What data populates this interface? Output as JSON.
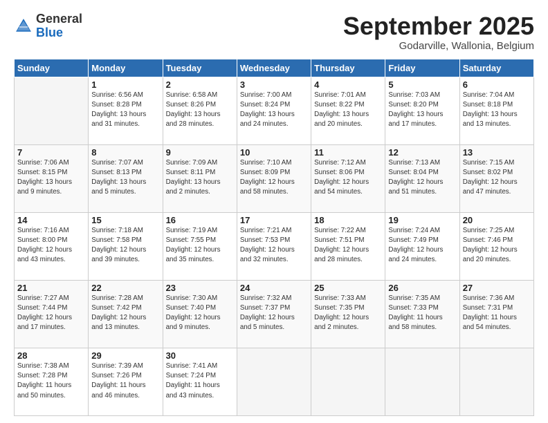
{
  "logo": {
    "general": "General",
    "blue": "Blue"
  },
  "title": {
    "month": "September 2025",
    "location": "Godarville, Wallonia, Belgium"
  },
  "weekdays": [
    "Sunday",
    "Monday",
    "Tuesday",
    "Wednesday",
    "Thursday",
    "Friday",
    "Saturday"
  ],
  "weeks": [
    [
      {
        "day": "",
        "info": ""
      },
      {
        "day": "1",
        "info": "Sunrise: 6:56 AM\nSunset: 8:28 PM\nDaylight: 13 hours\nand 31 minutes."
      },
      {
        "day": "2",
        "info": "Sunrise: 6:58 AM\nSunset: 8:26 PM\nDaylight: 13 hours\nand 28 minutes."
      },
      {
        "day": "3",
        "info": "Sunrise: 7:00 AM\nSunset: 8:24 PM\nDaylight: 13 hours\nand 24 minutes."
      },
      {
        "day": "4",
        "info": "Sunrise: 7:01 AM\nSunset: 8:22 PM\nDaylight: 13 hours\nand 20 minutes."
      },
      {
        "day": "5",
        "info": "Sunrise: 7:03 AM\nSunset: 8:20 PM\nDaylight: 13 hours\nand 17 minutes."
      },
      {
        "day": "6",
        "info": "Sunrise: 7:04 AM\nSunset: 8:18 PM\nDaylight: 13 hours\nand 13 minutes."
      }
    ],
    [
      {
        "day": "7",
        "info": "Sunrise: 7:06 AM\nSunset: 8:15 PM\nDaylight: 13 hours\nand 9 minutes."
      },
      {
        "day": "8",
        "info": "Sunrise: 7:07 AM\nSunset: 8:13 PM\nDaylight: 13 hours\nand 5 minutes."
      },
      {
        "day": "9",
        "info": "Sunrise: 7:09 AM\nSunset: 8:11 PM\nDaylight: 13 hours\nand 2 minutes."
      },
      {
        "day": "10",
        "info": "Sunrise: 7:10 AM\nSunset: 8:09 PM\nDaylight: 12 hours\nand 58 minutes."
      },
      {
        "day": "11",
        "info": "Sunrise: 7:12 AM\nSunset: 8:06 PM\nDaylight: 12 hours\nand 54 minutes."
      },
      {
        "day": "12",
        "info": "Sunrise: 7:13 AM\nSunset: 8:04 PM\nDaylight: 12 hours\nand 51 minutes."
      },
      {
        "day": "13",
        "info": "Sunrise: 7:15 AM\nSunset: 8:02 PM\nDaylight: 12 hours\nand 47 minutes."
      }
    ],
    [
      {
        "day": "14",
        "info": "Sunrise: 7:16 AM\nSunset: 8:00 PM\nDaylight: 12 hours\nand 43 minutes."
      },
      {
        "day": "15",
        "info": "Sunrise: 7:18 AM\nSunset: 7:58 PM\nDaylight: 12 hours\nand 39 minutes."
      },
      {
        "day": "16",
        "info": "Sunrise: 7:19 AM\nSunset: 7:55 PM\nDaylight: 12 hours\nand 35 minutes."
      },
      {
        "day": "17",
        "info": "Sunrise: 7:21 AM\nSunset: 7:53 PM\nDaylight: 12 hours\nand 32 minutes."
      },
      {
        "day": "18",
        "info": "Sunrise: 7:22 AM\nSunset: 7:51 PM\nDaylight: 12 hours\nand 28 minutes."
      },
      {
        "day": "19",
        "info": "Sunrise: 7:24 AM\nSunset: 7:49 PM\nDaylight: 12 hours\nand 24 minutes."
      },
      {
        "day": "20",
        "info": "Sunrise: 7:25 AM\nSunset: 7:46 PM\nDaylight: 12 hours\nand 20 minutes."
      }
    ],
    [
      {
        "day": "21",
        "info": "Sunrise: 7:27 AM\nSunset: 7:44 PM\nDaylight: 12 hours\nand 17 minutes."
      },
      {
        "day": "22",
        "info": "Sunrise: 7:28 AM\nSunset: 7:42 PM\nDaylight: 12 hours\nand 13 minutes."
      },
      {
        "day": "23",
        "info": "Sunrise: 7:30 AM\nSunset: 7:40 PM\nDaylight: 12 hours\nand 9 minutes."
      },
      {
        "day": "24",
        "info": "Sunrise: 7:32 AM\nSunset: 7:37 PM\nDaylight: 12 hours\nand 5 minutes."
      },
      {
        "day": "25",
        "info": "Sunrise: 7:33 AM\nSunset: 7:35 PM\nDaylight: 12 hours\nand 2 minutes."
      },
      {
        "day": "26",
        "info": "Sunrise: 7:35 AM\nSunset: 7:33 PM\nDaylight: 11 hours\nand 58 minutes."
      },
      {
        "day": "27",
        "info": "Sunrise: 7:36 AM\nSunset: 7:31 PM\nDaylight: 11 hours\nand 54 minutes."
      }
    ],
    [
      {
        "day": "28",
        "info": "Sunrise: 7:38 AM\nSunset: 7:28 PM\nDaylight: 11 hours\nand 50 minutes."
      },
      {
        "day": "29",
        "info": "Sunrise: 7:39 AM\nSunset: 7:26 PM\nDaylight: 11 hours\nand 46 minutes."
      },
      {
        "day": "30",
        "info": "Sunrise: 7:41 AM\nSunset: 7:24 PM\nDaylight: 11 hours\nand 43 minutes."
      },
      {
        "day": "",
        "info": ""
      },
      {
        "day": "",
        "info": ""
      },
      {
        "day": "",
        "info": ""
      },
      {
        "day": "",
        "info": ""
      }
    ]
  ]
}
